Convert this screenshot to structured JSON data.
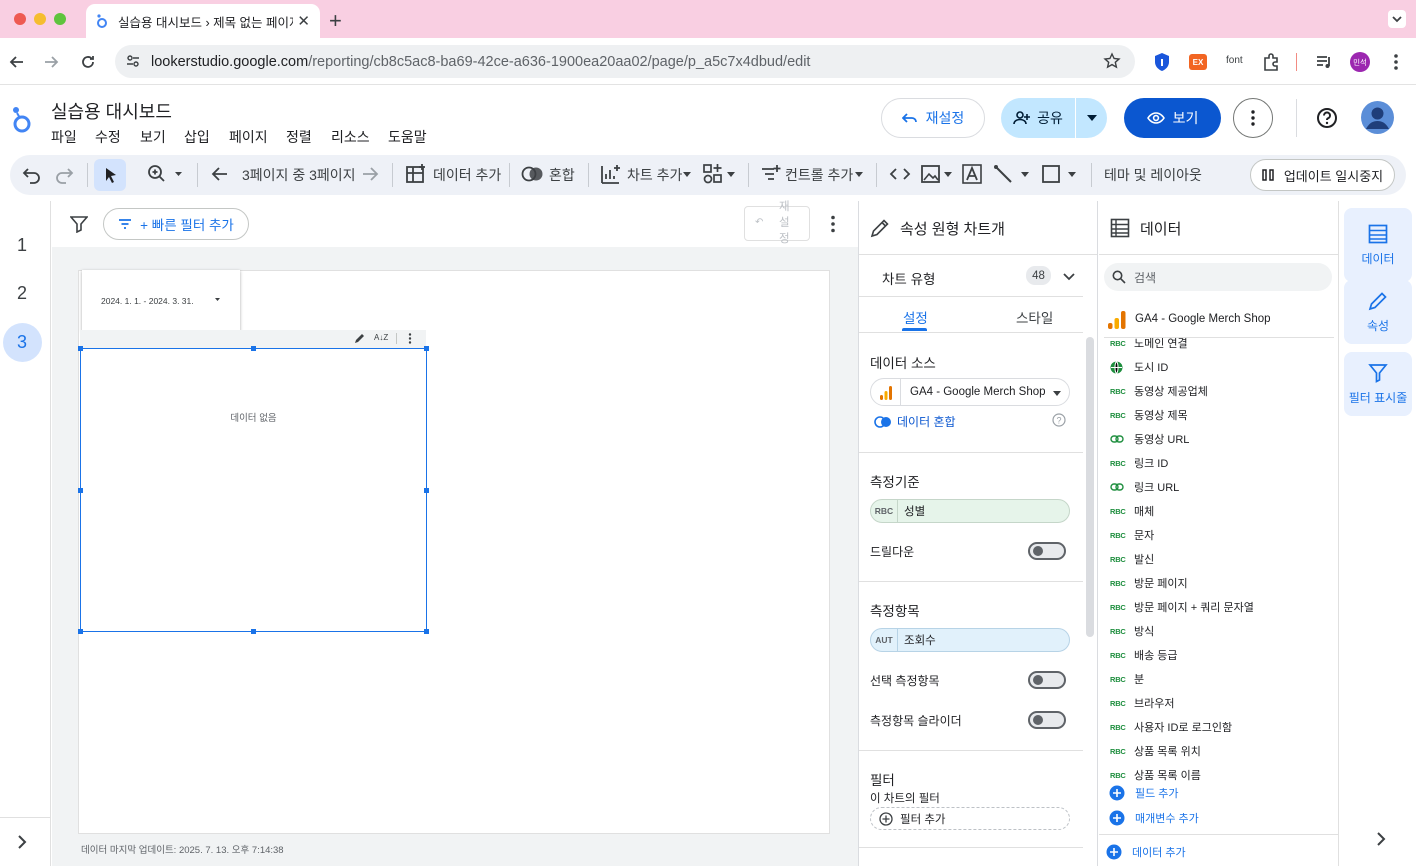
{
  "browser": {
    "tab_title": "실습용 대시보드 › 제목 없는 페이지",
    "url_host": "lookerstudio.google.com",
    "url_path": "/reporting/cb8c5ac8-ba69-42ce-a636-1900ea20aa02/page/p_a5c7x4dbud/edit",
    "ext_font_label": "font",
    "ext_ex_label": "EX",
    "profile_label": "민석"
  },
  "app": {
    "title": "실습용 대시보드",
    "menu": [
      "파일",
      "수정",
      "보기",
      "삽입",
      "페이지",
      "정렬",
      "리소스",
      "도움말"
    ],
    "reset_label": "재설정",
    "share_label": "공유",
    "view_label": "보기"
  },
  "toolbar": {
    "page_nav": "3페이지 중 3페이지",
    "add_data": "데이터 추가",
    "blend": "혼합",
    "add_chart": "차트 추가",
    "add_control": "컨트롤 추가",
    "theme_layout": "테마 및 레이아웃",
    "pause_updates": "업데이트 일시중지"
  },
  "pages": [
    "1",
    "2",
    "3"
  ],
  "canvas": {
    "quick_filter": "+ 빠른 필터 추가",
    "reset_vertical": "재설정",
    "date_range": "2024. 1. 1. - 2024. 3. 31.",
    "no_data": "데이터 없음",
    "last_updated": "데이터 마지막 업데이트: 2025. 7. 13. 오후 7:14:38"
  },
  "props": {
    "header": "속성 원형 차트개",
    "chart_type_label": "차트 유형",
    "chart_type_badge": "48",
    "tab_setup": "설정",
    "tab_style": "스타일",
    "data_source_title": "데이터 소스",
    "data_source_value": "GA4 - Google Merch Shop",
    "blend_data": "데이터 혼합",
    "dimension_title": "측정기준",
    "dimension_tag": "RBC",
    "dimension_value": "성별",
    "drilldown": "드릴다운",
    "metric_title": "측정항목",
    "metric_tag": "AUT",
    "metric_value": "조회수",
    "optional_metrics": "선택 측정항목",
    "metric_slider": "측정항목 슬라이더",
    "filter_title": "필터",
    "chart_filter": "이 차트의 필터",
    "add_filter": "필터 추가"
  },
  "datapanel": {
    "header": "데이터",
    "search_placeholder": "검색",
    "source": "GA4 - Google Merch Shop",
    "fields": [
      {
        "type": "RBC",
        "name": "노메인 연결"
      },
      {
        "type": "geo",
        "name": "도시 ID"
      },
      {
        "type": "RBC",
        "name": "동영상 제공업체"
      },
      {
        "type": "RBC",
        "name": "동영상 제목"
      },
      {
        "type": "link",
        "name": "동영상 URL"
      },
      {
        "type": "RBC",
        "name": "링크 ID"
      },
      {
        "type": "link",
        "name": "링크 URL"
      },
      {
        "type": "RBC",
        "name": "매체"
      },
      {
        "type": "RBC",
        "name": "문자"
      },
      {
        "type": "RBC",
        "name": "발신"
      },
      {
        "type": "RBC",
        "name": "방문 페이지"
      },
      {
        "type": "RBC",
        "name": "방문 페이지 + 쿼리 문자열"
      },
      {
        "type": "RBC",
        "name": "방식"
      },
      {
        "type": "RBC",
        "name": "배송 등급"
      },
      {
        "type": "RBC",
        "name": "분"
      },
      {
        "type": "RBC",
        "name": "브라우저"
      },
      {
        "type": "RBC",
        "name": "사용자 ID로 로그인함"
      },
      {
        "type": "RBC",
        "name": "상품 목록 위치"
      },
      {
        "type": "RBC",
        "name": "상품 목록 이름"
      }
    ],
    "add_field": "필드 추가",
    "add_param": "매개변수 추가",
    "add_data": "데이터 추가"
  },
  "rail": {
    "data": "데이터",
    "props": "속성",
    "filter": "필터 표시줄"
  },
  "colors": {
    "accent": "#1a73e8",
    "tabbar": "#f9cfe2",
    "toolbar": "#eef1f7",
    "dimension_chip": "#e6f4ea",
    "metric_chip": "#e1f1fb"
  }
}
